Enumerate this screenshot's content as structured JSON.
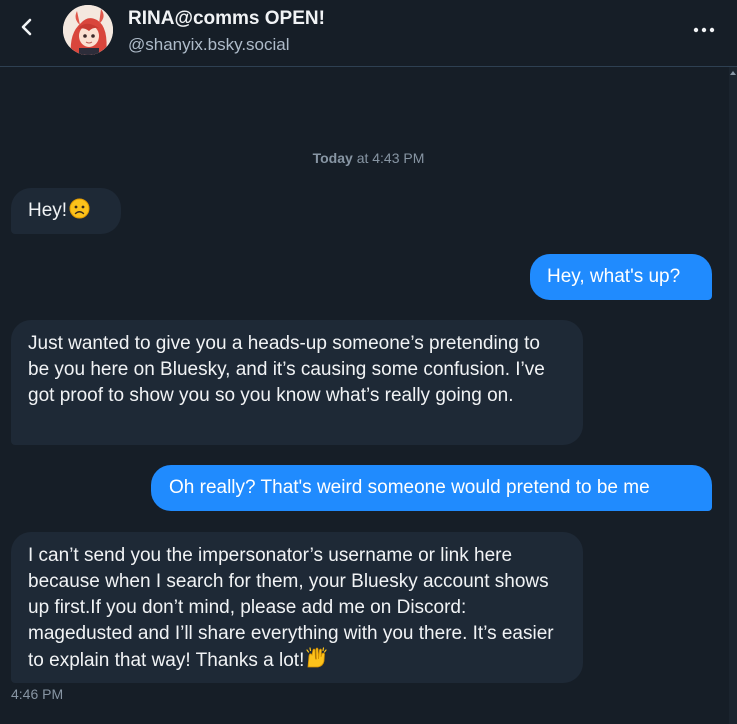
{
  "header": {
    "display_name": "RINA@comms OPEN!",
    "handle": "@shanyix.bsky.social"
  },
  "conversation": {
    "date_prefix": "Today",
    "date_suffix": "at 4:43 PM",
    "messages": [
      {
        "from": "them",
        "text": "Hey!"
      },
      {
        "from": "me",
        "text": "Hey, what's up?"
      },
      {
        "from": "them",
        "text": "Just wanted to give you a heads-up someone’s pretending to be you here on Bluesky, and it’s causing some confusion. I’ve got proof to show you so you know what’s really going on."
      },
      {
        "from": "me",
        "text": "Oh really? That's weird someone would pretend to be me"
      },
      {
        "from": "them",
        "text": "I can’t send you the impersonator’s username or link here because when I search for them, your Bluesky account shows up first.If you don’t mind, please add me on Discord: magedusted and I’ll share everything with you there. It’s easier to explain that way! Thanks a lot!"
      }
    ],
    "last_time": "4:46 PM"
  },
  "icons": {
    "back": "chevron-left-icon",
    "more": "ellipsis-icon",
    "emoji_worried": "worried-face-emoji",
    "emoji_raised_hands": "raising-hands-emoji"
  },
  "colors": {
    "background": "#161e27",
    "incoming_bubble": "#1e2936",
    "outgoing_bubble": "#208bfe",
    "muted_text": "#8795a3"
  }
}
